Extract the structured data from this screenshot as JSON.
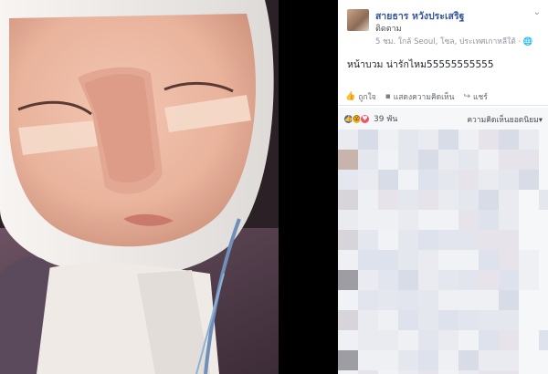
{
  "post": {
    "author": "สายธาร หวังประเสริฐ",
    "follow_label": "ติดตาม",
    "meta": "5 ชม. ใกล้ Seoul, โซล, ประเทศเกาหลีใต้ · ",
    "text": "หน้าบวม น่ารักไหม55555555555"
  },
  "actions": {
    "like": "ถูกใจ",
    "comment": "แสดงความคิดเห็น",
    "share": "แชร์"
  },
  "reactions": {
    "count": "39 พัน",
    "sort_label": "ความคิดเห็นยอดนิยม"
  },
  "icons": [
    "chevron-down-icon",
    "like-icon",
    "comment-icon",
    "share-icon",
    "globe-icon"
  ],
  "colors": {
    "link": "#365899",
    "like": "#4267b2",
    "love": "#f25268",
    "wow": "#f7b125"
  }
}
